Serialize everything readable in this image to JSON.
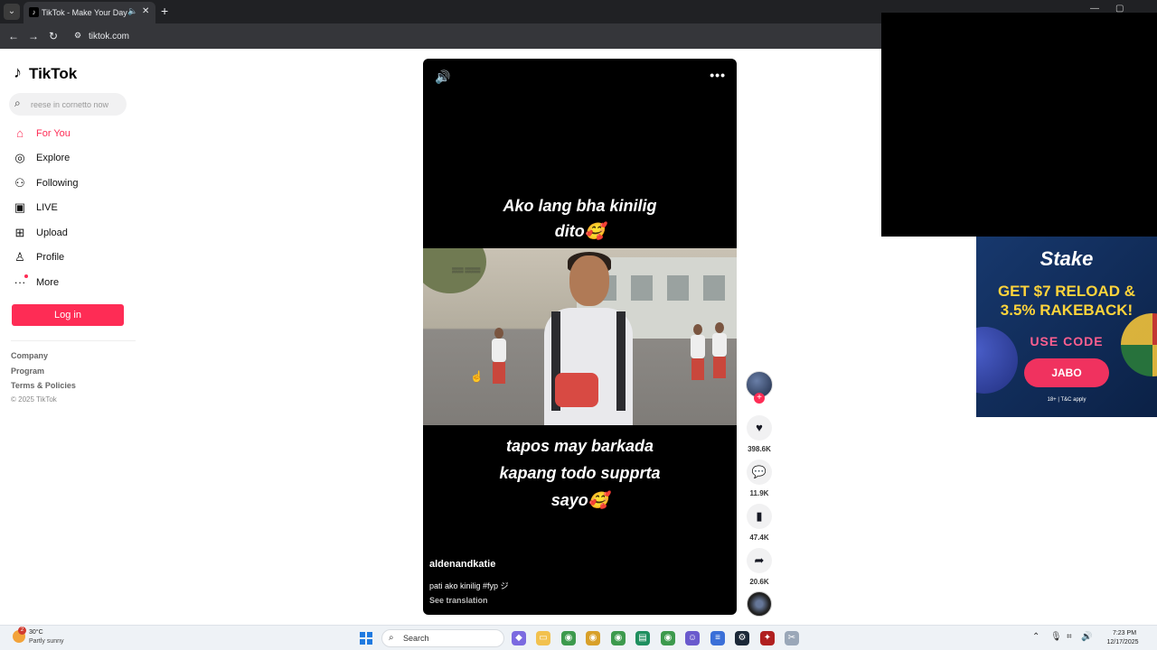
{
  "browser": {
    "tab_title": "TikTok - Make Your Day",
    "url": "tiktok.com",
    "icons": {
      "back": "back-arrow-icon",
      "forward": "forward-arrow-icon",
      "reload": "reload-icon",
      "mute": "speaker-icon",
      "close": "close-icon",
      "new_tab": "plus-icon"
    }
  },
  "sidebar": {
    "logo": "TikTok",
    "search_placeholder": "reese in cornetto now",
    "nav": [
      {
        "label": "For You",
        "icon": "home-icon",
        "active": true
      },
      {
        "label": "Explore",
        "icon": "compass-icon"
      },
      {
        "label": "Following",
        "icon": "following-icon"
      },
      {
        "label": "LIVE",
        "icon": "live-icon"
      },
      {
        "label": "Upload",
        "icon": "upload-icon"
      },
      {
        "label": "Profile",
        "icon": "profile-icon"
      },
      {
        "label": "More",
        "icon": "more-icon"
      }
    ],
    "login_label": "Log in",
    "footer": {
      "company": "Company",
      "program": "Program",
      "terms": "Terms & Policies",
      "copyright": "© 2025 TikTok"
    }
  },
  "video": {
    "caption_top_line1": "Ako lang bha kinilig",
    "caption_top_line2": "dito🥰",
    "caption_bottom_line1": "tapos may barkada",
    "caption_bottom_line2": "kapang todo supprta",
    "caption_bottom_line3": "sayo🥰",
    "author": "aldenandkatie",
    "description": "pati ako kinilig #fyp ジ",
    "see_translation": "See translation"
  },
  "actions": {
    "likes": "398.6K",
    "comments": "11.9K",
    "saves": "47.4K",
    "shares": "20.6K"
  },
  "ad": {
    "brand": "Stake",
    "headline_line1": "GET $7 RELOAD &",
    "headline_line2": "3.5% RAKEBACK!",
    "use_code": "USE CODE",
    "code": "JABO",
    "fine_print": "18+ | T&C apply"
  },
  "taskbar": {
    "weather_temp": "30°C",
    "weather_desc": "Partly sunny",
    "weather_badge": "2",
    "search_label": "Search",
    "time": "7:23 PM",
    "date": "12/17/2025"
  },
  "colors": {
    "accent": "#fe2c55",
    "ad_bg": "#17386d",
    "ad_yellow": "#ffd43b"
  }
}
